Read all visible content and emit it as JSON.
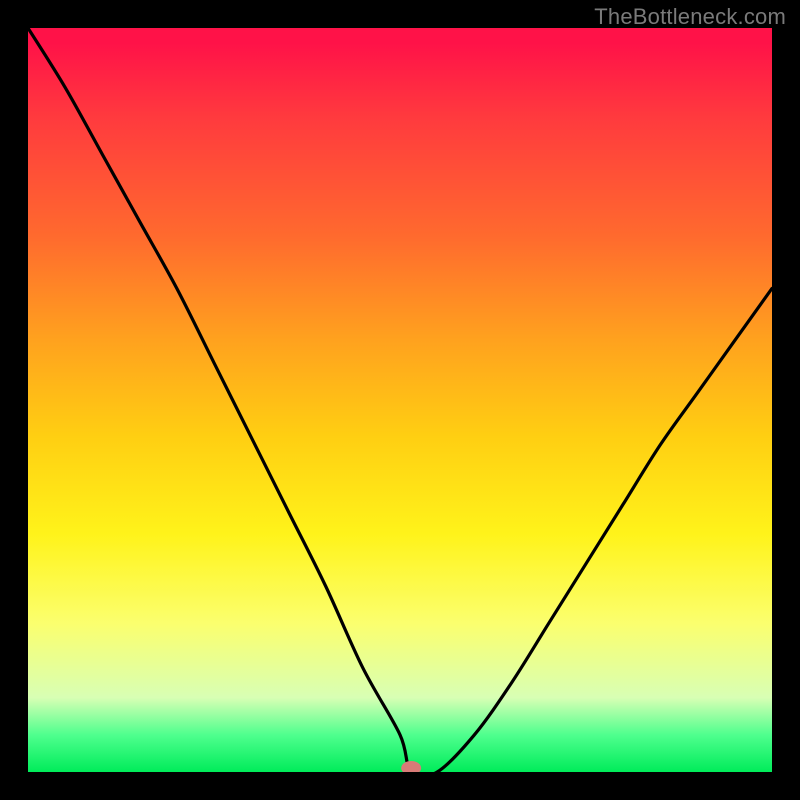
{
  "watermark": "TheBottleneck.com",
  "chart_data": {
    "type": "line",
    "title": "",
    "xlabel": "",
    "ylabel": "",
    "xlim": [
      0,
      100
    ],
    "ylim": [
      0,
      100
    ],
    "background_gradient": {
      "top": "#ff1248",
      "mid": "#fff31a",
      "bottom": "#00ec5a"
    },
    "series": [
      {
        "name": "bottleneck-curve",
        "x": [
          0,
          5,
          10,
          15,
          20,
          25,
          30,
          35,
          40,
          45,
          50,
          51.5,
          55,
          60,
          65,
          70,
          75,
          80,
          85,
          90,
          95,
          100
        ],
        "y": [
          100,
          92,
          83,
          74,
          65,
          55,
          45,
          35,
          25,
          14,
          5,
          0,
          0,
          5,
          12,
          20,
          28,
          36,
          44,
          51,
          58,
          65
        ]
      }
    ],
    "annotations": [
      {
        "name": "optimal-marker",
        "x": 51.5,
        "y": 0,
        "color": "#d87b77"
      }
    ]
  }
}
